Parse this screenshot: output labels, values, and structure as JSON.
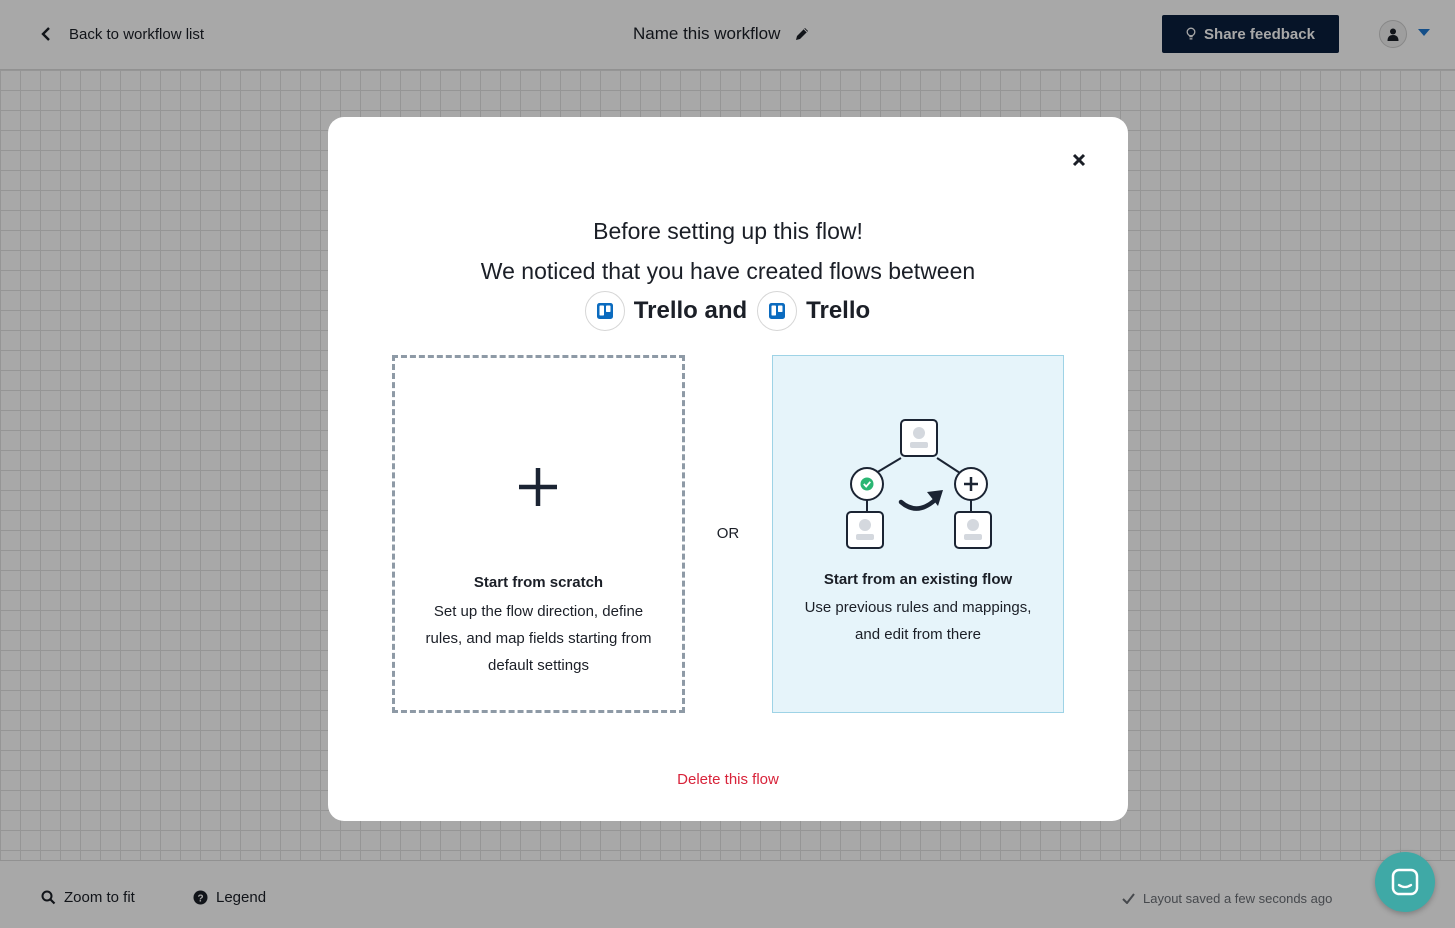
{
  "header": {
    "back_label": "Back to workflow list",
    "workflow_title": "Name this workflow",
    "share_feedback_label": "Share feedback",
    "accent_color": "#0a1f3d"
  },
  "footer": {
    "zoom_label": "Zoom to fit",
    "legend_label": "Legend",
    "saved_status": "Layout saved a few seconds ago"
  },
  "modal": {
    "heading": "Before setting up this flow!",
    "subheading": "We noticed that you have created flows between",
    "apps": [
      {
        "name": "Trello and",
        "icon": "trello-icon"
      },
      {
        "name": "Trello",
        "icon": "trello-icon"
      }
    ],
    "or_label": "OR",
    "cards": [
      {
        "title": "Start from scratch",
        "description": "Set up the flow direction, define rules, and map fields starting from default settings",
        "icon": "plus-icon"
      },
      {
        "title": "Start from an existing flow",
        "description": "Use previous rules and mappings, and edit from there",
        "icon": "flow-illustration"
      }
    ],
    "delete_label": "Delete this flow",
    "delete_color": "#d8233a"
  },
  "chat": {
    "icon": "chat-icon",
    "color": "#3fa9a6"
  }
}
